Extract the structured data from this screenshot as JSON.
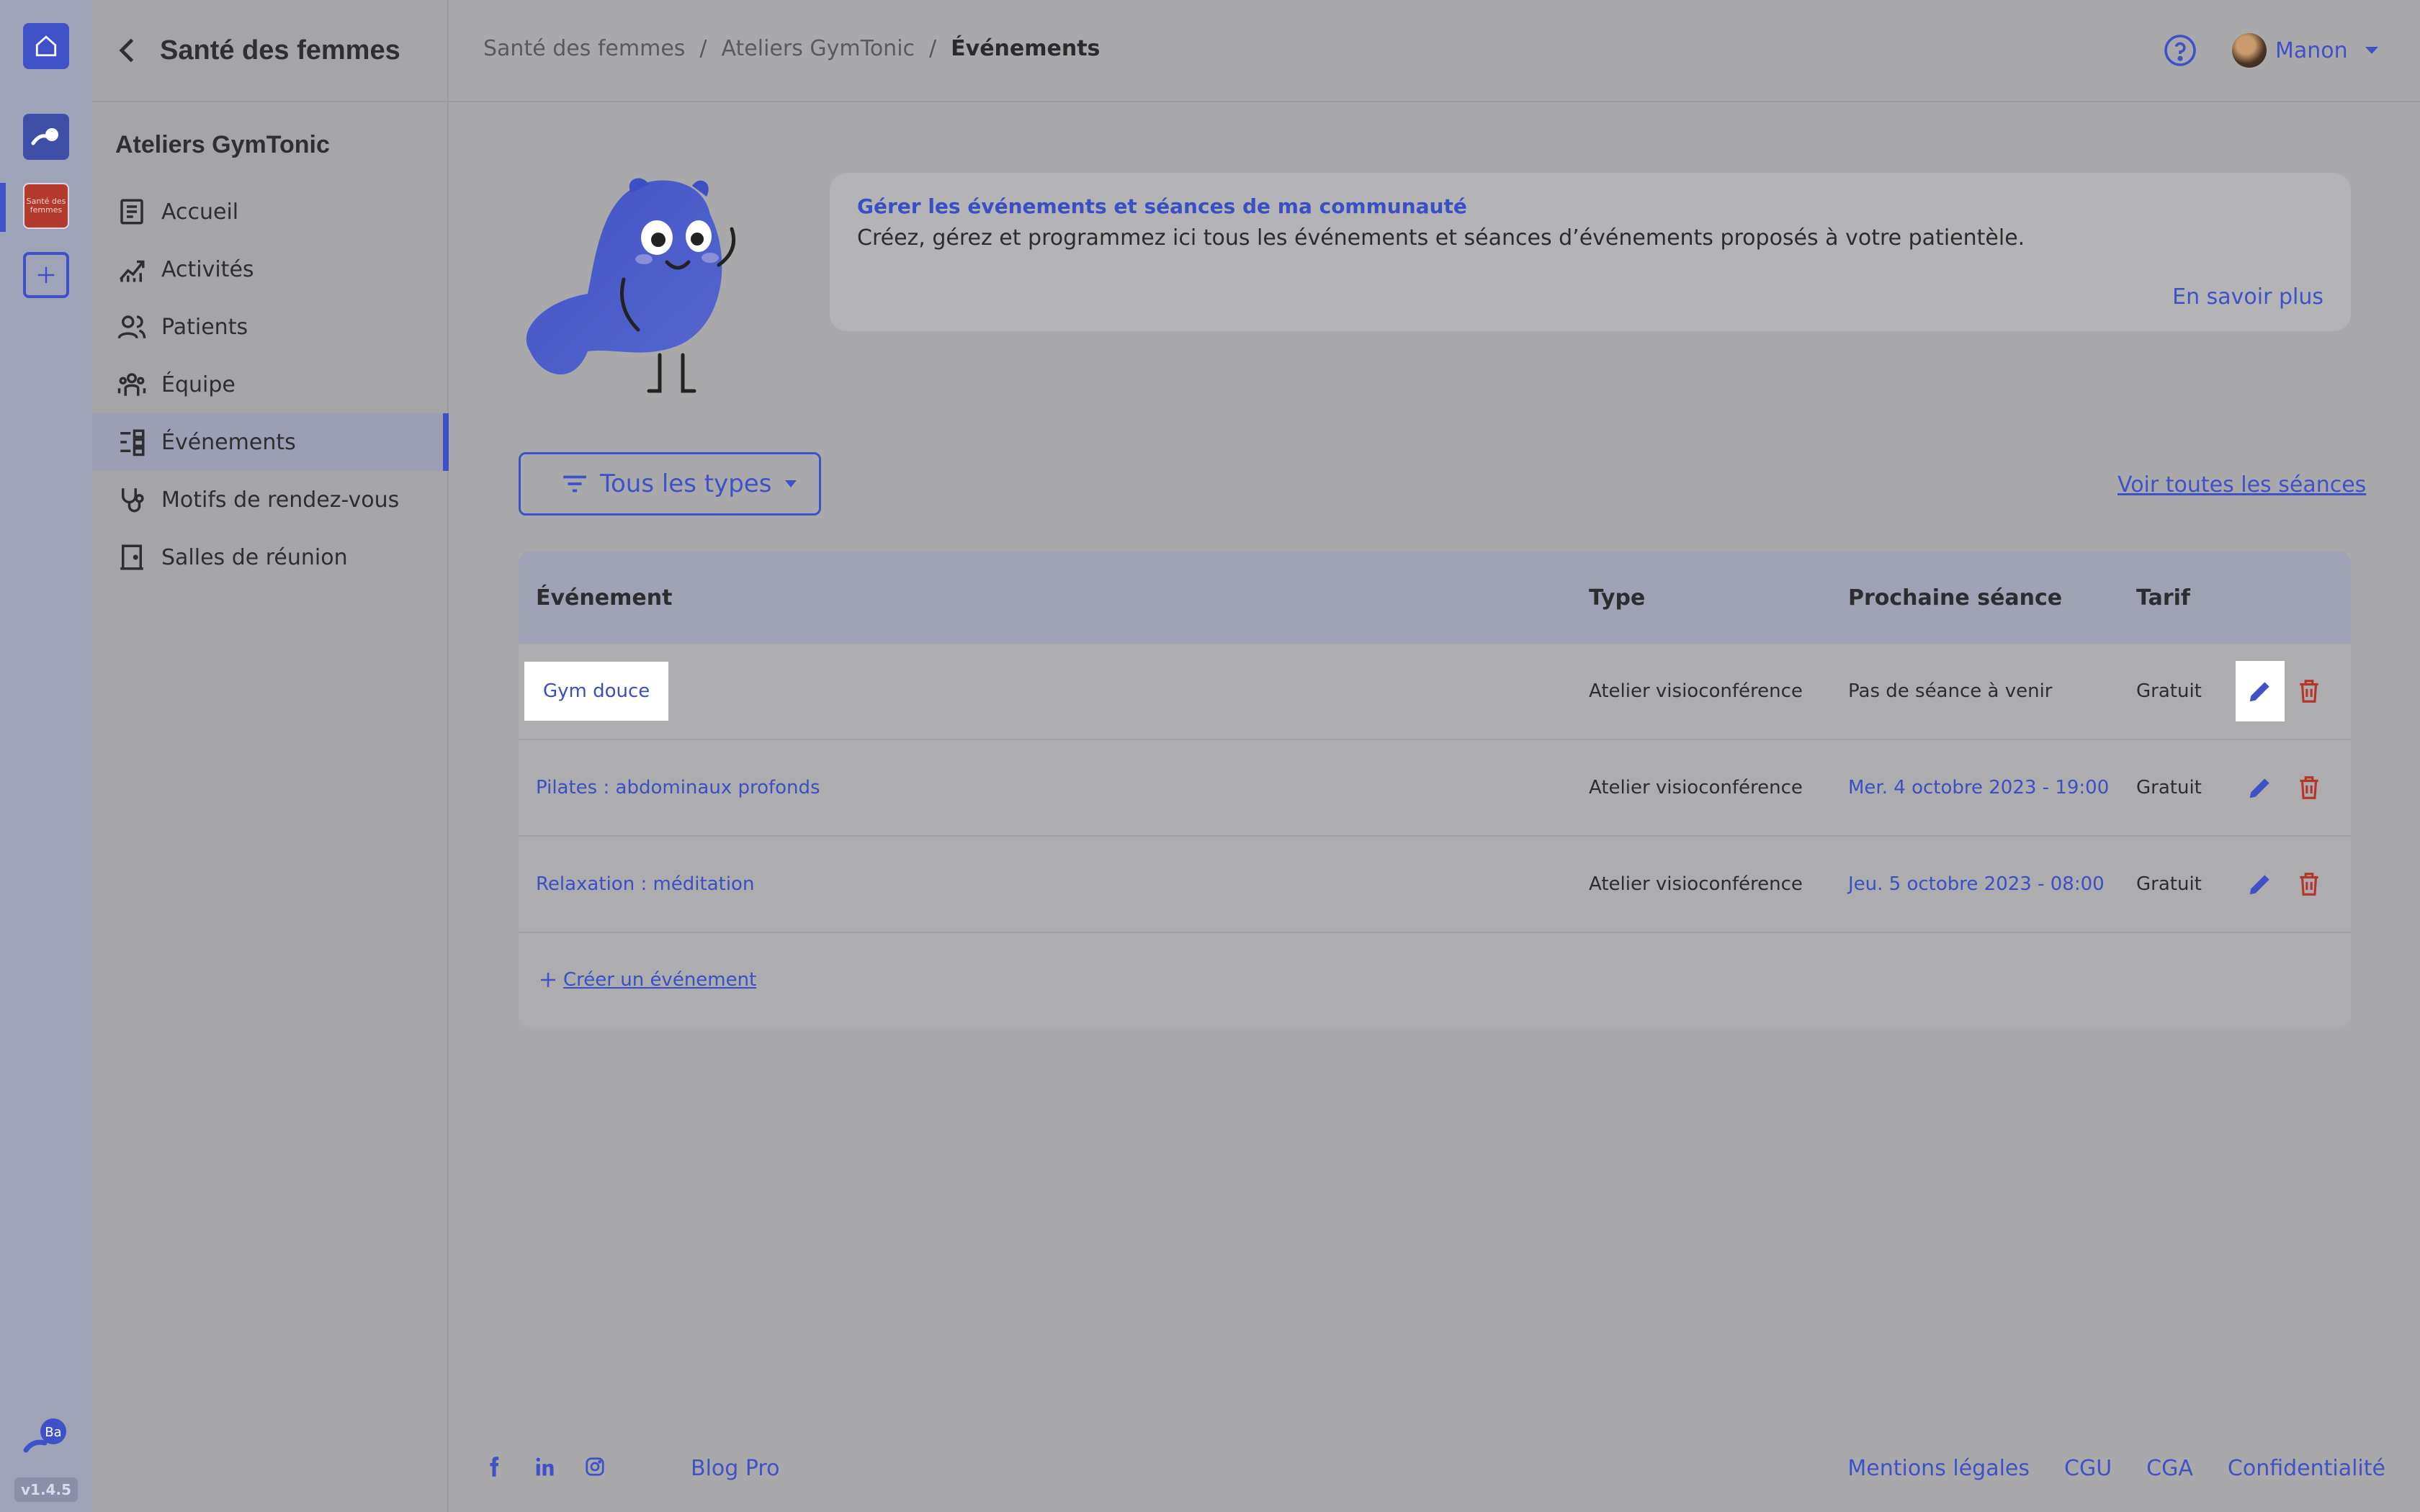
{
  "rail": {
    "org_text": "Santé des femmes",
    "logo_text": "Ba",
    "version": "v1.4.5"
  },
  "sidebar": {
    "title": "Santé des femmes",
    "section": "Ateliers GymTonic",
    "items": [
      {
        "label": "Accueil",
        "icon": "document-icon"
      },
      {
        "label": "Activités",
        "icon": "chart-icon"
      },
      {
        "label": "Patients",
        "icon": "people-icon"
      },
      {
        "label": "Équipe",
        "icon": "team-icon"
      },
      {
        "label": "Événements",
        "icon": "events-icon",
        "active": true
      },
      {
        "label": "Motifs de rendez-vous",
        "icon": "stethoscope-icon"
      },
      {
        "label": "Salles de réunion",
        "icon": "door-icon"
      }
    ]
  },
  "topbar": {
    "breadcrumb": [
      "Santé des femmes",
      "Ateliers GymTonic",
      "Événements"
    ],
    "user_name": "Manon"
  },
  "info": {
    "title": "Gérer les événements et séances de ma communauté",
    "text": "Créez, gérez et programmez ici tous les événements et séances d’événements proposés à votre patientèle.",
    "more": "En savoir plus"
  },
  "filter": {
    "label": "Tous les types"
  },
  "see_all": "Voir toutes les séances",
  "table": {
    "headers": {
      "event": "Événement",
      "type": "Type",
      "next": "Prochaine séance",
      "tarif": "Tarif"
    },
    "rows": [
      {
        "event": "Gym douce",
        "type": "Atelier visioconférence",
        "next": "Pas de séance à venir",
        "tarif": "Gratuit"
      },
      {
        "event": "Pilates : abdominaux profonds",
        "type": "Atelier visioconférence",
        "next": "Mer. 4 octobre 2023 - 19:00",
        "tarif": "Gratuit"
      },
      {
        "event": "Relaxation : méditation",
        "type": "Atelier visioconférence",
        "next": "Jeu. 5 octobre 2023 - 08:00",
        "tarif": "Gratuit"
      }
    ],
    "create": "Créer un événement"
  },
  "footer": {
    "blog": "Blog Pro",
    "links": [
      "Mentions légales",
      "CGU",
      "CGA",
      "Confidentialité"
    ]
  },
  "colors": {
    "accent": "#3f51c6",
    "danger": "#b5352b"
  }
}
